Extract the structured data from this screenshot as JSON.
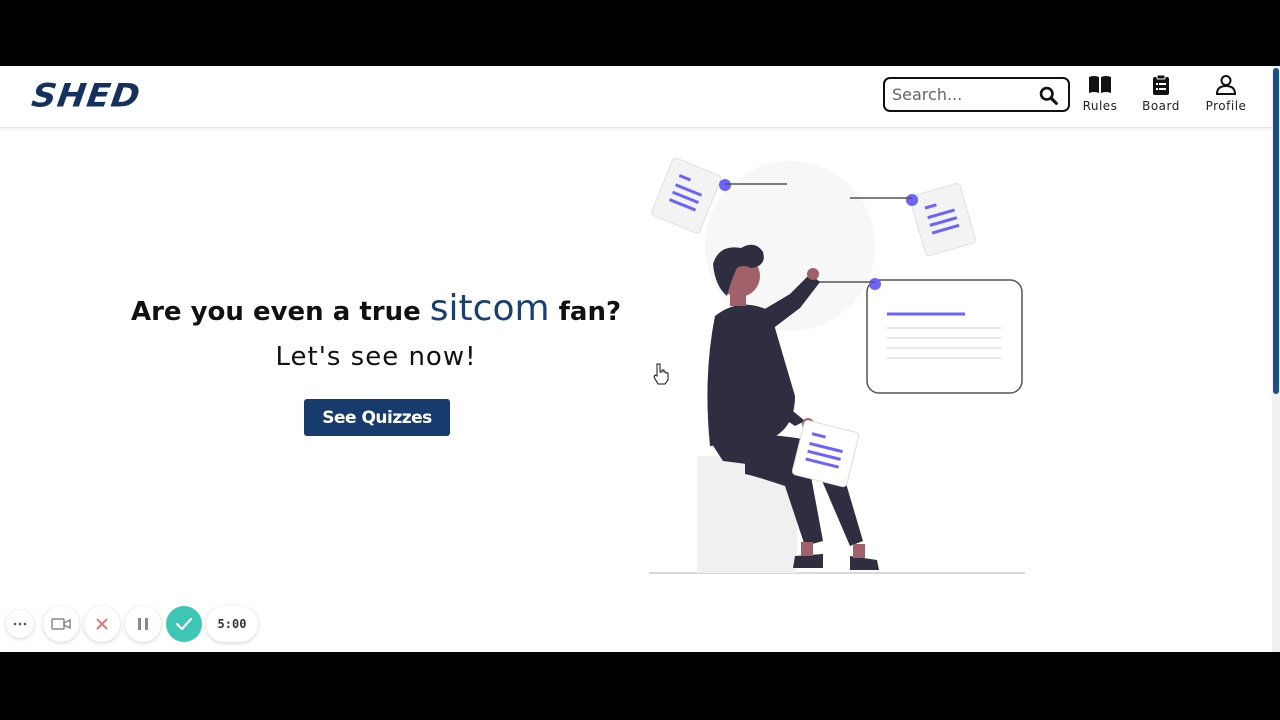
{
  "header": {
    "logo": "SHED",
    "search_placeholder": "Search...",
    "nav": [
      {
        "label": "Rules",
        "icon": "book-icon"
      },
      {
        "label": "Board",
        "icon": "clipboard-icon"
      },
      {
        "label": "Profile",
        "icon": "user-icon"
      }
    ]
  },
  "hero": {
    "title_before": "Are you even a true ",
    "title_accent": "sitcom",
    "title_after": " fan?",
    "subtitle": "Let's see now!",
    "cta_label": "See Quizzes"
  },
  "recorder": {
    "timer": "5:00"
  },
  "colors": {
    "brand": "#16305e",
    "accent": "#1b3f73",
    "cta": "#183b6e",
    "illustration_accent": "#6c63ff",
    "recorder_check": "#3cc6b3"
  }
}
